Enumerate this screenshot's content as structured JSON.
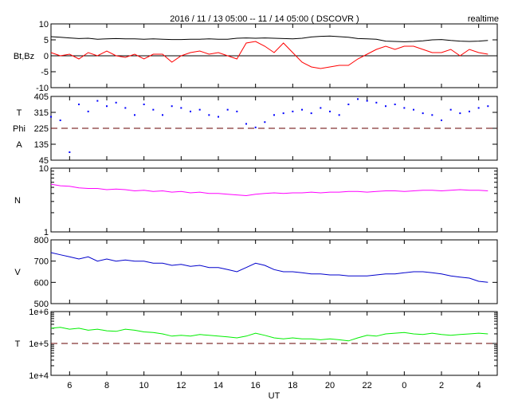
{
  "chart_data": [
    {
      "type": "line",
      "title": "2016 / 11 / 13   05:00 -- 11 / 14   05:00 ( DSCOVR )",
      "badge": "realtime",
      "ylabel": "Bt,Bz",
      "ylim": [
        -10,
        10
      ],
      "yticks": [
        "10",
        "5",
        "0",
        "-5",
        "-10"
      ],
      "ytick_values": [
        10,
        5,
        0,
        -5,
        -10
      ],
      "scale": "linear",
      "ref_line": 0,
      "ref_style": "solid",
      "series": [
        {
          "name": "Bt",
          "color": "#000000",
          "values": [
            6,
            5.8,
            5.6,
            5.4,
            5.5,
            5.2,
            5.3,
            5.4,
            5.3,
            5.3,
            5.2,
            5.3,
            5.2,
            5.1,
            5.1,
            5.2,
            5.2,
            5.3,
            5.2,
            5.2,
            5.5,
            5.6,
            5.5,
            5.6,
            5.5,
            5.4,
            5.3,
            5.5,
            5.9,
            6.1,
            6.2,
            6,
            5.8,
            5.4,
            5.3,
            5.2,
            4.6,
            4.5,
            4.4,
            4.5,
            4.7,
            5,
            5.1,
            4.8,
            4.6,
            4.5,
            4.6,
            4.8
          ]
        },
        {
          "name": "Bz",
          "color": "#ff0000",
          "values": [
            1,
            0,
            0.5,
            -1,
            1,
            0,
            1.5,
            0,
            -0.5,
            0.5,
            -1,
            0.5,
            0.5,
            -2,
            0,
            1,
            1.5,
            0.5,
            1,
            0,
            -1,
            4,
            4.5,
            3,
            1,
            4,
            1,
            -2,
            -3.5,
            -4,
            -3.5,
            -3,
            -3,
            -1,
            0.5,
            2,
            3,
            2,
            3,
            3,
            2,
            1,
            1,
            2,
            0,
            2,
            1,
            0.5
          ]
        }
      ]
    },
    {
      "type": "scatter",
      "ylabel_lines": [
        "T",
        "Phi",
        "A"
      ],
      "ylim": [
        45,
        405
      ],
      "yticks": [
        "405",
        "315",
        "225",
        "135",
        "45"
      ],
      "ytick_values": [
        405,
        315,
        225,
        135,
        45
      ],
      "scale": "linear",
      "ref_line": 225,
      "ref_style": "dashed",
      "series": [
        {
          "name": "Phi",
          "color": "#0000ff",
          "values": [
            290,
            270,
            90,
            360,
            320,
            380,
            350,
            370,
            340,
            300,
            360,
            330,
            300,
            350,
            340,
            320,
            330,
            300,
            290,
            330,
            320,
            250,
            230,
            260,
            300,
            310,
            320,
            330,
            310,
            340,
            320,
            300,
            360,
            390,
            380,
            370,
            350,
            360,
            340,
            330,
            310,
            300,
            270,
            330,
            310,
            320,
            340,
            350
          ]
        }
      ]
    },
    {
      "type": "line",
      "ylabel": "N",
      "ylim": [
        1,
        10
      ],
      "yticks": [
        "10",
        "1"
      ],
      "ytick_values": [
        10,
        1
      ],
      "scale": "log",
      "series": [
        {
          "name": "N",
          "color": "#ff00ff",
          "values": [
            5.6,
            5.3,
            5.2,
            4.9,
            4.8,
            4.8,
            4.6,
            4.7,
            4.6,
            4.4,
            4.5,
            4.3,
            4.4,
            4.2,
            4.3,
            4.1,
            4.2,
            4.0,
            4.0,
            3.9,
            3.8,
            3.7,
            3.9,
            4.0,
            4.1,
            4.0,
            4.1,
            4.1,
            4.2,
            4.1,
            4.2,
            4.2,
            4.3,
            4.3,
            4.2,
            4.3,
            4.4,
            4.4,
            4.3,
            4.4,
            4.5,
            4.5,
            4.4,
            4.5,
            4.6,
            4.5,
            4.5,
            4.4
          ]
        }
      ]
    },
    {
      "type": "line",
      "ylabel": "V",
      "ylim": [
        500,
        800
      ],
      "yticks": [
        "800",
        "700",
        "600",
        "500"
      ],
      "ytick_values": [
        800,
        700,
        600,
        500
      ],
      "scale": "linear",
      "series": [
        {
          "name": "V",
          "color": "#0000cc",
          "values": [
            740,
            730,
            720,
            710,
            720,
            700,
            710,
            700,
            705,
            700,
            700,
            690,
            690,
            680,
            685,
            675,
            680,
            670,
            670,
            660,
            650,
            670,
            690,
            680,
            660,
            650,
            650,
            645,
            640,
            640,
            635,
            635,
            630,
            630,
            630,
            635,
            640,
            640,
            645,
            650,
            650,
            645,
            640,
            630,
            625,
            620,
            605,
            600
          ]
        }
      ]
    },
    {
      "type": "line",
      "ylabel": "T",
      "ylim": [
        10000.0,
        1000000.0
      ],
      "yticks": [
        "1e+6",
        "1e+5",
        "1e+4"
      ],
      "ytick_values": [
        1000000,
        100000,
        10000
      ],
      "scale": "log",
      "ref_line": 100000,
      "ref_style": "dashed",
      "series": [
        {
          "name": "T",
          "color": "#00ee00",
          "values": [
            300000,
            320000,
            280000,
            300000,
            260000,
            280000,
            250000,
            240000,
            280000,
            260000,
            230000,
            220000,
            200000,
            170000,
            180000,
            170000,
            190000,
            180000,
            170000,
            160000,
            150000,
            170000,
            210000,
            180000,
            150000,
            140000,
            150000,
            140000,
            140000,
            130000,
            140000,
            130000,
            120000,
            150000,
            180000,
            170000,
            200000,
            210000,
            220000,
            200000,
            190000,
            210000,
            190000,
            180000,
            190000,
            200000,
            210000,
            200000
          ]
        }
      ]
    }
  ],
  "x_axis": {
    "label": "UT",
    "start_hour": 5,
    "step_hours": 0.5,
    "range_hours": [
      5,
      29
    ],
    "tick_labels": [
      "6",
      "8",
      "10",
      "12",
      "14",
      "16",
      "18",
      "20",
      "22",
      "0",
      "2",
      "4"
    ],
    "tick_hours": [
      6,
      8,
      10,
      12,
      14,
      16,
      18,
      20,
      22,
      24,
      26,
      28
    ]
  }
}
